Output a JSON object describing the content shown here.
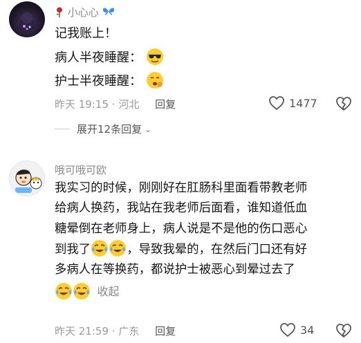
{
  "comment1": {
    "username": "小心心",
    "lines": [
      "记我账上！",
      "病人半夜睡醒：",
      "护士半夜睡醒："
    ],
    "time": "昨天 19:15",
    "location": "河北",
    "reply_label": "回复",
    "likes": "1477"
  },
  "expand_replies": "展开12条回复",
  "comment2": {
    "username": "哦可哦可欧",
    "text_lines": [
      "我实习的时候，刚刚好在肛肠科里面看带教老师",
      "给病人换药，我站在我老师后面看，谁知道低血",
      "糖晕倒在老师身上，病人说是不是他的伤口恶心",
      "到我了",
      "，导致我晕的，在然后门口还有好",
      "多病人在等换药，都说护士被恶心到晕过去了"
    ],
    "collapse_label": "收起",
    "time": "昨天 21:59",
    "location": "广东",
    "reply_label": "回复",
    "likes": "34"
  },
  "icons": {
    "rose": "rose-icon",
    "butterfly": "butterfly-icon",
    "cool_face": "sunglasses-face-emoji",
    "tired_face": "yawning-face-emoji",
    "cry_laugh": "cry-laugh-emoji",
    "heart": "heart-outline-icon",
    "broken_heart": "broken-heart-icon"
  }
}
